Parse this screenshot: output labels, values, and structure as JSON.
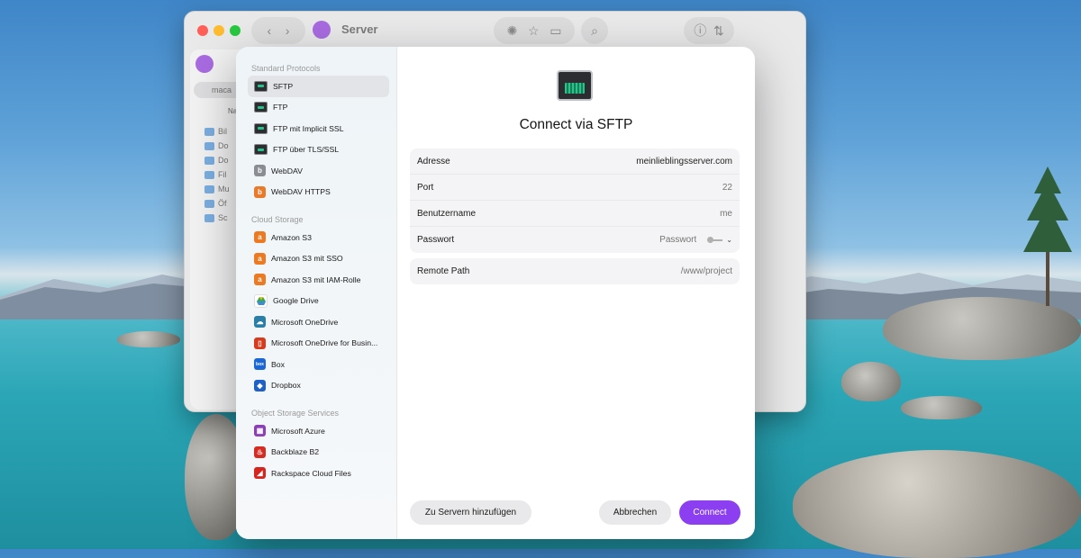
{
  "window": {
    "title": "Server",
    "sidebar_ghost": {
      "location": "maca",
      "column": "Na",
      "folders": [
        "Bil",
        "Do",
        "Do",
        "Fil",
        "Mu",
        "Öf",
        "Sc"
      ]
    }
  },
  "sidebar": {
    "sections": [
      {
        "heading": "Standard Protocols",
        "items": [
          {
            "label": "SFTP",
            "icon": "ethernet-icon",
            "selected": true
          },
          {
            "label": "FTP",
            "icon": "ethernet-icon"
          },
          {
            "label": "FTP mit Implicit SSL",
            "icon": "ethernet-icon"
          },
          {
            "label": "FTP über TLS/SSL",
            "icon": "ethernet-icon"
          },
          {
            "label": "WebDAV",
            "icon": "webdav-icon"
          },
          {
            "label": "WebDAV HTTPS",
            "icon": "webdav-https-icon"
          }
        ]
      },
      {
        "heading": "Cloud Storage",
        "items": [
          {
            "label": "Amazon S3",
            "icon": "amazon-s3-icon"
          },
          {
            "label": "Amazon S3 mit SSO",
            "icon": "amazon-s3-icon"
          },
          {
            "label": "Amazon S3 mit IAM-Rolle",
            "icon": "amazon-s3-icon"
          },
          {
            "label": "Google Drive",
            "icon": "google-drive-icon"
          },
          {
            "label": "Microsoft OneDrive",
            "icon": "onedrive-icon"
          },
          {
            "label": "Microsoft OneDrive for Busin...",
            "icon": "onedrive-business-icon"
          },
          {
            "label": "Box",
            "icon": "box-icon"
          },
          {
            "label": "Dropbox",
            "icon": "dropbox-icon"
          }
        ]
      },
      {
        "heading": "Object Storage Services",
        "items": [
          {
            "label": "Microsoft Azure",
            "icon": "azure-icon"
          },
          {
            "label": "Backblaze B2",
            "icon": "backblaze-icon"
          },
          {
            "label": "Rackspace Cloud Files",
            "icon": "rackspace-icon"
          }
        ]
      }
    ]
  },
  "main": {
    "title": "Connect via SFTP",
    "fields": {
      "address": {
        "label": "Adresse",
        "value": "meinlieblingsserver.com"
      },
      "port": {
        "label": "Port",
        "placeholder": "22"
      },
      "username": {
        "label": "Benutzername",
        "placeholder": "me"
      },
      "password": {
        "label": "Passwort",
        "placeholder": "Passwort"
      },
      "remote_path": {
        "label": "Remote Path",
        "placeholder": "/www/project"
      }
    },
    "buttons": {
      "add_to_servers": "Zu Servern hinzufügen",
      "cancel": "Abbrechen",
      "connect": "Connect"
    }
  },
  "colors": {
    "accent": "#8b3ff0",
    "selection": "#e2e4e7"
  }
}
